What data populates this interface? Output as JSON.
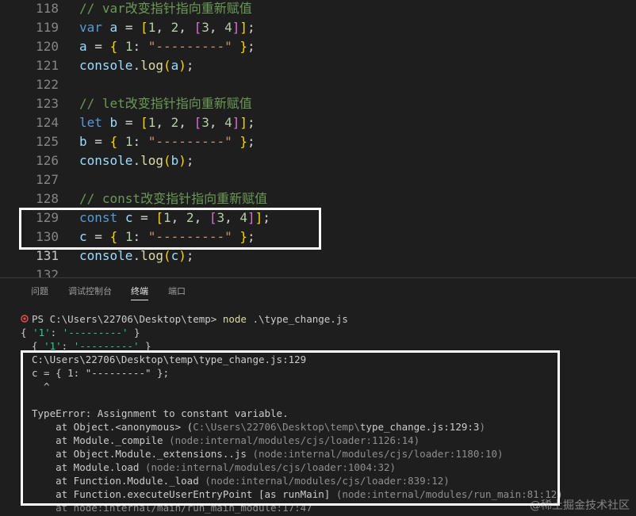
{
  "editor": {
    "lines": [
      {
        "num": "118",
        "type": "comment",
        "text": "// var改变指针指向重新赋值"
      },
      {
        "num": "119",
        "type": "decl",
        "kw": "var",
        "name": "a",
        "n1": "1",
        "n2": "2",
        "n3": "3",
        "n4": "4"
      },
      {
        "num": "120",
        "type": "assign",
        "name": "a",
        "key": "1",
        "str": "\"---------\""
      },
      {
        "num": "121",
        "type": "log",
        "obj": "console",
        "fn": "log",
        "arg": "a"
      },
      {
        "num": "122",
        "type": "blank"
      },
      {
        "num": "123",
        "type": "comment",
        "text": "// let改变指针指向重新赋值"
      },
      {
        "num": "124",
        "type": "decl",
        "kw": "let",
        "name": "b",
        "n1": "1",
        "n2": "2",
        "n3": "3",
        "n4": "4"
      },
      {
        "num": "125",
        "type": "assign",
        "name": "b",
        "key": "1",
        "str": "\"---------\""
      },
      {
        "num": "126",
        "type": "log",
        "obj": "console",
        "fn": "log",
        "arg": "b"
      },
      {
        "num": "127",
        "type": "blank"
      },
      {
        "num": "128",
        "type": "comment",
        "text": "// const改变指针指向重新赋值"
      },
      {
        "num": "129",
        "type": "decl",
        "kw": "const",
        "name": "c",
        "n1": "1",
        "n2": "2",
        "n3": "3",
        "n4": "4"
      },
      {
        "num": "130",
        "type": "assign",
        "name": "c",
        "key": "1",
        "str": "\"---------\""
      },
      {
        "num": "131",
        "type": "log",
        "obj": "console",
        "fn": "log",
        "arg": "c"
      },
      {
        "num": "132",
        "type": "blank"
      }
    ]
  },
  "panel": {
    "tabs": [
      "问题",
      "调试控制台",
      "终端",
      "端口"
    ],
    "active_tab": "终端"
  },
  "terminal": {
    "prompt": "PS C:\\Users\\22706\\Desktop\\temp>",
    "command": "node",
    "command_arg": ".\\type_change.js",
    "output_a": [
      "{ '1': '---------' }",
      "{ '1': '---------' }"
    ],
    "error_location": "C:\\Users\\22706\\Desktop\\temp\\type_change.js:129",
    "error_code": "c = { 1: \"---------\" };",
    "error_caret": "  ^",
    "error_message": "TypeError: Assignment to constant variable.",
    "stack_first": {
      "at": "    at Object.<anonymous> (",
      "path_dim": "C:\\Users\\22706\\Desktop\\temp\\",
      "file": "type_change.js:129:3",
      ")": ")"
    },
    "stack": [
      "    at Module._compile (node:internal/modules/cjs/loader:1126:14)",
      "    at Object.Module._extensions..js (node:internal/modules/cjs/loader:1180:10)",
      "    at Module.load (node:internal/modules/cjs/loader:1004:32)",
      "    at Function.Module._load (node:internal/modules/cjs/loader:839:12)",
      "    at Function.executeUserEntryPoint [as runMain] (node:internal/modules/run_main:81:12)",
      "    at node:internal/main/run_main_module:17:47"
    ]
  },
  "watermark": "@稀土掘金技术社区",
  "colors": {
    "background": "#1e1e1e",
    "highlight_box": "#ffffff",
    "error_icon": "#f14c4c"
  }
}
